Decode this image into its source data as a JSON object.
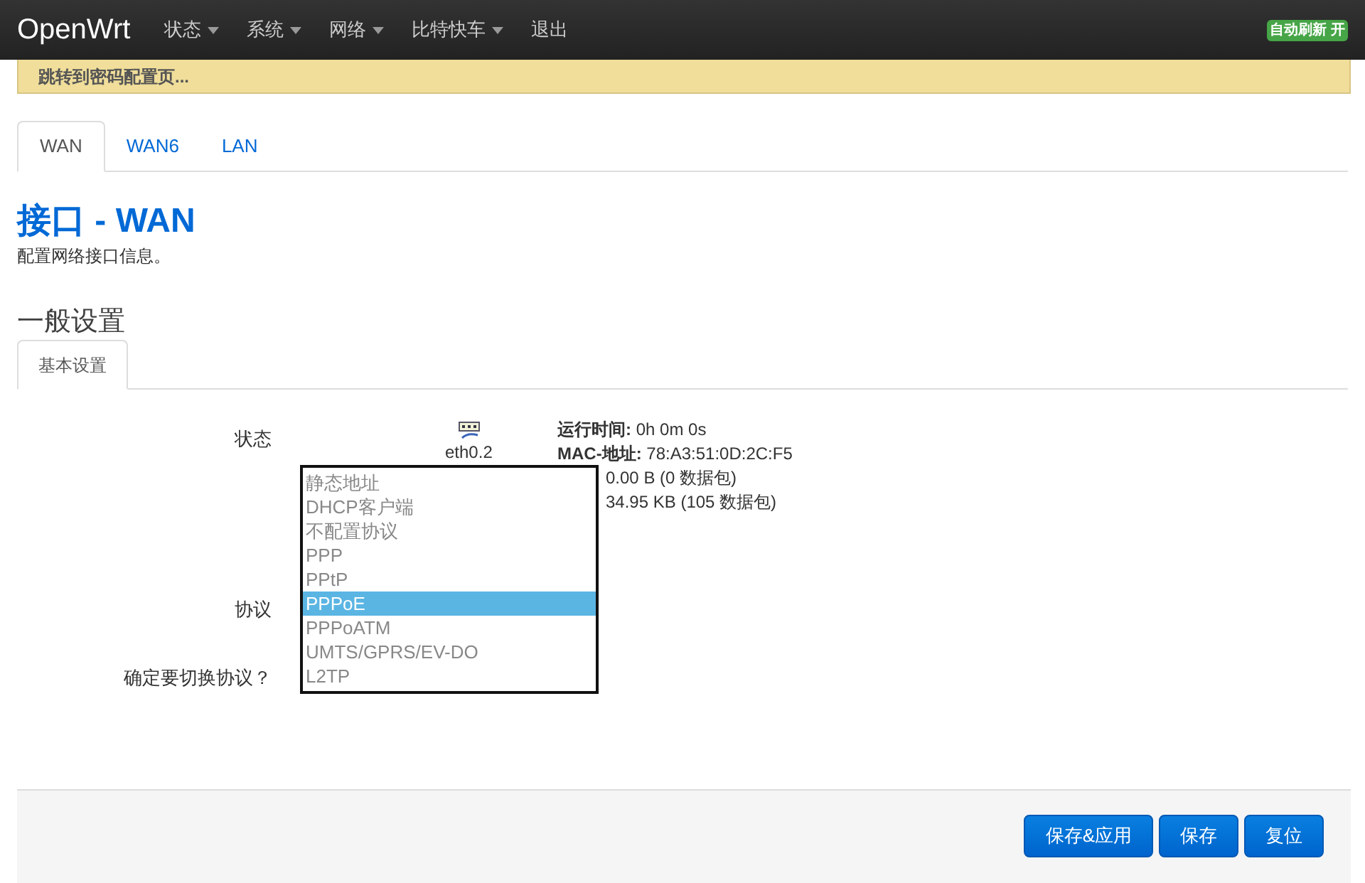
{
  "navbar": {
    "brand": "OpenWrt",
    "menus": [
      {
        "label": "状态",
        "caret": true
      },
      {
        "label": "系统",
        "caret": true
      },
      {
        "label": "网络",
        "caret": true
      },
      {
        "label": "比特快车",
        "caret": true
      },
      {
        "label": "退出",
        "caret": false
      }
    ],
    "badge": "自动刷新 开"
  },
  "alert": "跳转到密码配置页...",
  "tabs": [
    {
      "label": "WAN",
      "selected": true
    },
    {
      "label": "WAN6",
      "selected": false
    },
    {
      "label": "LAN",
      "selected": false
    }
  ],
  "title": "接口 - WAN",
  "description": "配置网络接口信息。",
  "section": {
    "title": "一般设置",
    "tabs": [
      {
        "label": "基本设置",
        "selected": true
      }
    ]
  },
  "status": {
    "label": "状态",
    "device": "eth0.2",
    "lines": [
      {
        "key": "运行时间:",
        "value": "0h 0m 0s"
      },
      {
        "key": "MAC-地址:",
        "value": "78:A3:51:0D:2C:F5"
      },
      {
        "value": "0.00 B (0 数据包)"
      },
      {
        "value": "34.95 KB (105 数据包)"
      }
    ]
  },
  "protocol": {
    "label": "协议",
    "options": [
      {
        "label": "静态地址",
        "selected": false
      },
      {
        "label": "DHCP客户端",
        "selected": false
      },
      {
        "label": "不配置协议",
        "selected": false
      },
      {
        "label": "PPP",
        "selected": false
      },
      {
        "label": "PPtP",
        "selected": false
      },
      {
        "label": "PPPoE",
        "selected": true
      },
      {
        "label": "PPPoATM",
        "selected": false
      },
      {
        "label": "UMTS/GPRS/EV-DO",
        "selected": false
      },
      {
        "label": "L2TP",
        "selected": false
      }
    ]
  },
  "confirm_label": "确定要切换协议？",
  "buttons": [
    "保存&应用",
    "保存",
    "复位"
  ]
}
